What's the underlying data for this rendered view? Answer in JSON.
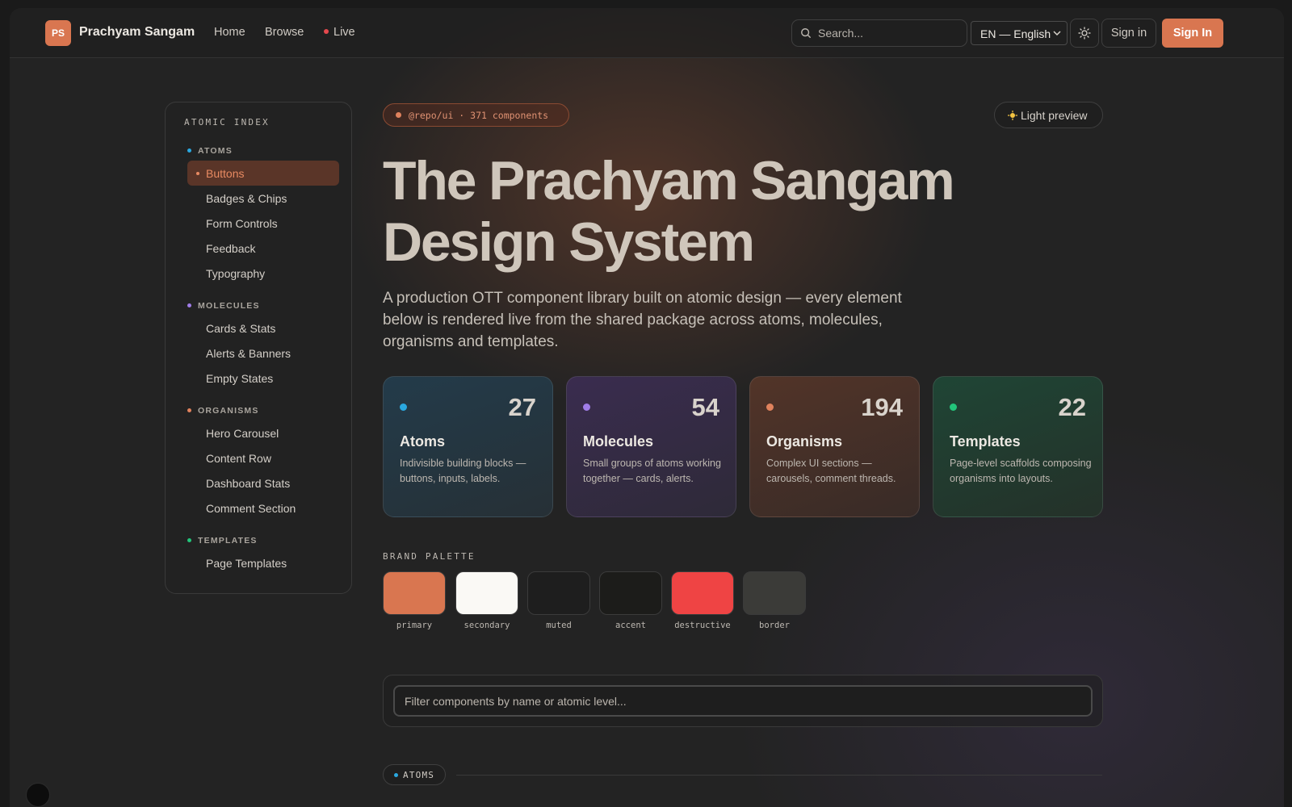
{
  "nav": {
    "logo": "PS",
    "brand": "Prachyam Sangam",
    "links": [
      "Home",
      "Browse",
      "Live"
    ],
    "search_placeholder": "Search...",
    "language": "EN — English",
    "signin_ghost": "Sign in",
    "signin_primary": "Sign In",
    "colors": {
      "primary": "#d97650",
      "live": "#e5484d"
    }
  },
  "sidebar": {
    "title": "ATOMIC INDEX",
    "groups": [
      {
        "label": "ATOMS",
        "color": "#2aa8e0",
        "items": [
          "Buttons",
          "Badges & Chips",
          "Form Controls",
          "Feedback",
          "Typography"
        ]
      },
      {
        "label": "MOLECULES",
        "color": "#a07de8",
        "items": [
          "Cards & Stats",
          "Alerts & Banners",
          "Empty States"
        ]
      },
      {
        "label": "ORGANISMS",
        "color": "#e0825d",
        "items": [
          "Hero Carousel",
          "Content Row",
          "Dashboard Stats",
          "Comment Section"
        ]
      },
      {
        "label": "TEMPLATES",
        "color": "#22c57a",
        "items": [
          "Page Templates"
        ]
      }
    ],
    "active_item": "Buttons"
  },
  "hero": {
    "pill": "@repo/ui · 371 components",
    "light_preview": "Light preview",
    "title_line1": "The Prachyam Sangam",
    "title_line2": "Design System",
    "description": "A production OTT component library built on atomic design — every element below is rendered live from the shared package across atoms, molecules, organisms and templates."
  },
  "stats": [
    {
      "title": "Atoms",
      "count": "27",
      "desc": "Indivisible building blocks — buttons, inputs, labels.",
      "dot": "#2aa8e0"
    },
    {
      "title": "Molecules",
      "count": "54",
      "desc": "Small groups of atoms working together — cards, alerts.",
      "dot": "#a07de8"
    },
    {
      "title": "Organisms",
      "count": "194",
      "desc": "Complex UI sections — carousels, comment threads.",
      "dot": "#e0825d"
    },
    {
      "title": "Templates",
      "count": "22",
      "desc": "Page-level scaffolds composing organisms into layouts.",
      "dot": "#22c57a"
    }
  ],
  "palette": {
    "label": "BRAND PALETTE",
    "swatches": [
      {
        "name": "primary",
        "color": "#d97650"
      },
      {
        "name": "secondary",
        "color": "#faf9f5"
      },
      {
        "name": "muted",
        "color": "#1e1e1e"
      },
      {
        "name": "accent",
        "color": "#1c1c1a"
      },
      {
        "name": "destructive",
        "color": "#ef4444"
      },
      {
        "name": "border",
        "color": "#3b3b38"
      }
    ]
  },
  "filter": {
    "placeholder": "Filter components by name or atomic level..."
  },
  "section": {
    "label": "ATOMS"
  }
}
